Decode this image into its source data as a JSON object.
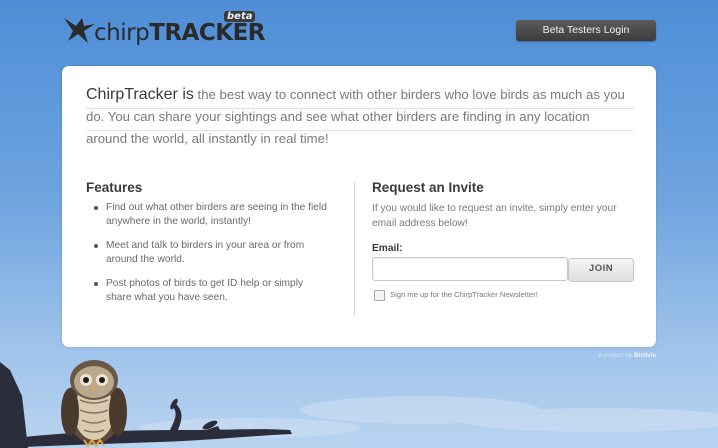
{
  "header": {
    "logo": {
      "text_bold": "chirp",
      "text_caps": "TRACKER",
      "badge": "beta",
      "icon": "bird-silhouette-icon"
    },
    "login_button_label": "Beta Testers Login"
  },
  "intro": {
    "brand": "ChirpTracker is",
    "text": " the best way to connect with other birders who love birds as much as you do. You can share your sightings and see what other birders are finding in any location around the world, all instantly in real time!"
  },
  "features": {
    "heading": "Features",
    "items": [
      "Find out what other birders are seeing in the field anywhere in the world, instantly!",
      "Meet and talk to birders in your area or from around the world.",
      "Post photos of birds to get ID help or simply share what you have seen."
    ]
  },
  "invite": {
    "heading": "Request an Invite",
    "description": "If you would like to request an invite, simply enter your email address below!",
    "email_label": "Email:",
    "email_value": "",
    "join_label": "JOIN",
    "newsletter_label": "Sign me up for the ChirpTracker Newsletter!",
    "newsletter_checked": false
  },
  "footer": {
    "credit_prefix": "A project by",
    "credit_brand": "Birdvie"
  },
  "colors": {
    "sky_top": "#4e8ed6",
    "sky_bottom": "#b9d4f0",
    "button_dark": "#3c3c3c",
    "card_bg": "#ffffff",
    "branch": "#2b2e3a"
  }
}
